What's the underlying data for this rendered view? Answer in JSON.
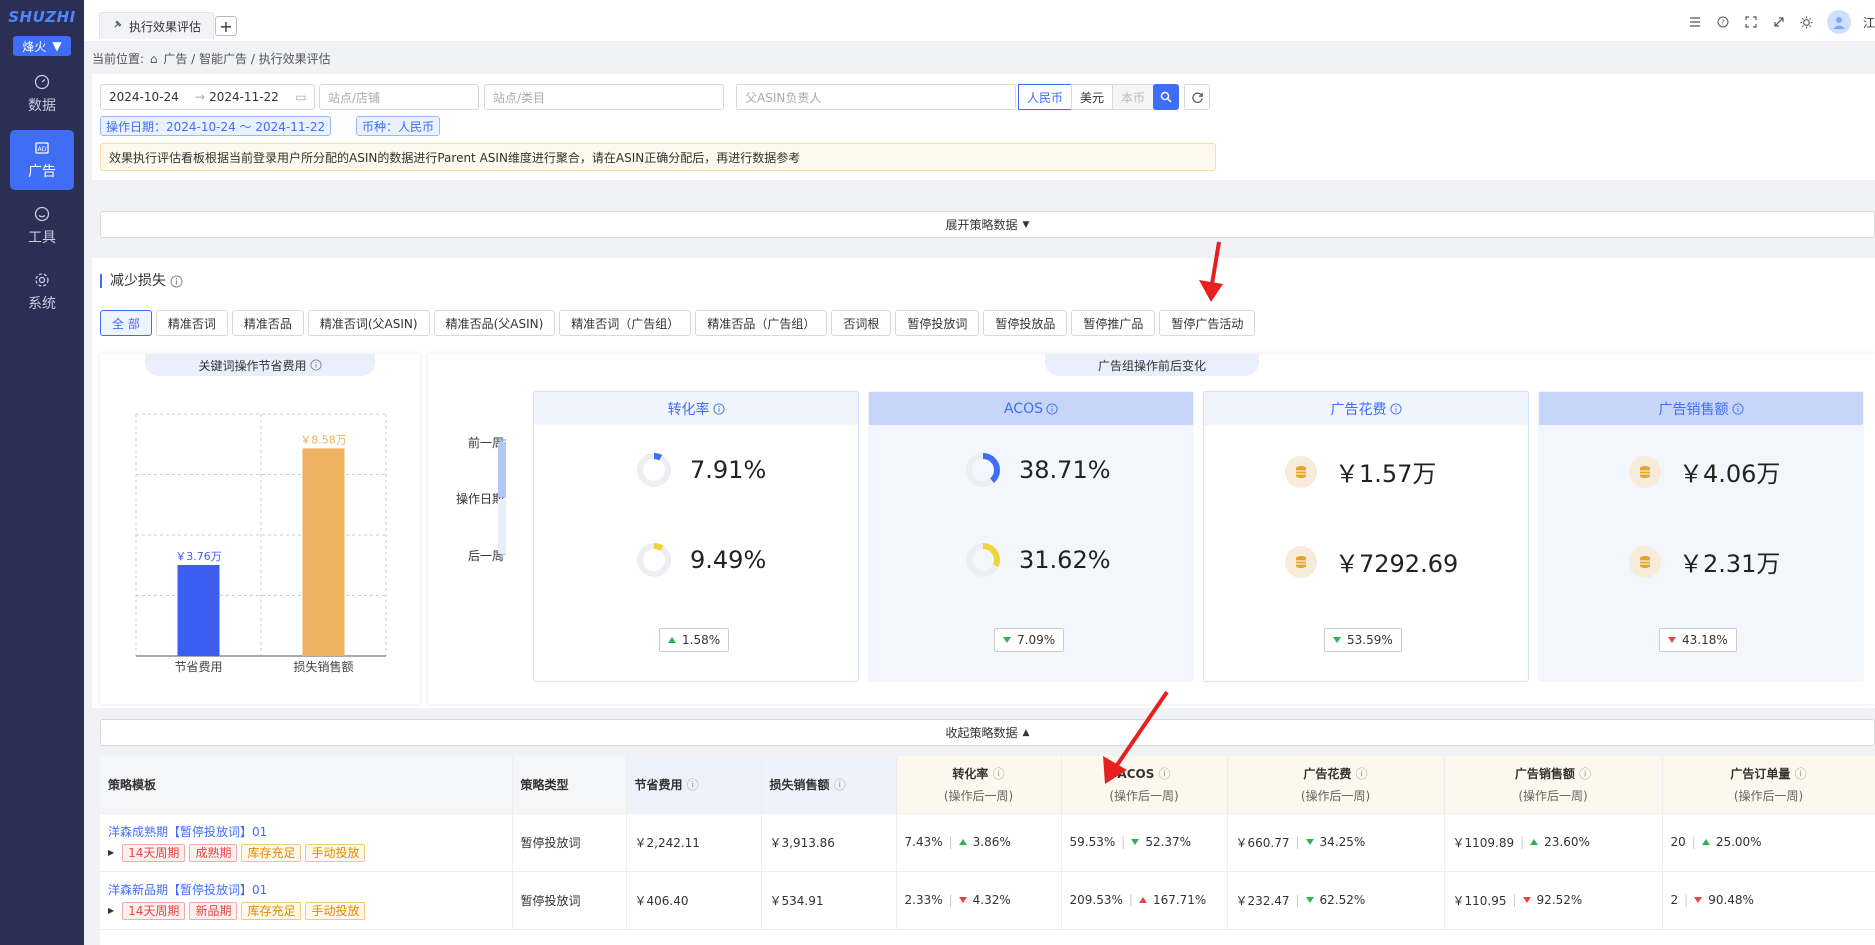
{
  "sidebar": {
    "logo": "SHUZHI",
    "shop": "烽火",
    "items": [
      {
        "label": "数据",
        "icon": "dashboard-icon"
      },
      {
        "label": "广告",
        "icon": "ads-icon"
      },
      {
        "label": "工具",
        "icon": "tool-icon"
      },
      {
        "label": "系统",
        "icon": "gear-icon"
      }
    ],
    "active": "广告"
  },
  "topbar": {
    "tab_label": "执行效果评估",
    "add_label": "+",
    "user_initial": "江",
    "icons": [
      "list-icon",
      "help-icon",
      "fullscreen-icon",
      "expand-icon",
      "theme-icon"
    ]
  },
  "breadcrumb": {
    "prefix": "当前位置:",
    "path": "广告 / 智能广告 / 执行效果评估"
  },
  "filters": {
    "date_start": "2024-10-24",
    "date_end": "2024-11-22",
    "site_store_placeholder": "站点/店铺",
    "site_category_placeholder": "站点/类目",
    "asin_owner_placeholder": "父ASIN负责人",
    "currencies": [
      "人民币",
      "美元",
      "本币"
    ],
    "active_currency": "人民币",
    "tag_date": "操作日期：2024-10-24 ～ 2024-11-22",
    "tag_currency": "币种：人民币",
    "notice": "效果执行评估看板根据当前登录用户所分配的ASIN的数据进行Parent ASIN维度进行聚合，请在ASIN正确分配后，再进行数据参考"
  },
  "expand_bar": "展开策略数据",
  "collapse_bar": "收起策略数据",
  "loss_section": {
    "title": "减少损失",
    "filters": [
      "全 部",
      "精准否词",
      "精准否品",
      "精准否词(父ASIN)",
      "精准否品(父ASIN)",
      "精准否词（广告组）",
      "精准否品（广告组）",
      "否词根",
      "暂停投放词",
      "暂停投放品",
      "暂停推广品",
      "暂停广告活动"
    ],
    "active_filter": "全 部"
  },
  "left_chart": {
    "header": "关键词操作节省费用"
  },
  "chart_data": {
    "type": "bar",
    "categories": [
      "节省费用",
      "损失销售额"
    ],
    "values": [
      3.76,
      8.58
    ],
    "data_labels": [
      "￥3.76万",
      "￥8.58万"
    ],
    "colors": [
      "#3b5ef0",
      "#efb05f"
    ],
    "ylim": [
      0,
      10
    ],
    "grid": true
  },
  "right_panel": {
    "header": "广告组操作前后变化",
    "timeline": [
      "前一周",
      "操作日期",
      "后一周"
    ],
    "metrics": [
      {
        "title": "转化率",
        "before": "7.91%",
        "after": "9.49%",
        "before_ratio": 0.0791,
        "after_ratio": 0.0949,
        "delta": "1.58%",
        "dir": "up",
        "kind": "ring"
      },
      {
        "title": "ACOS",
        "before": "38.71%",
        "after": "31.62%",
        "before_ratio": 0.3871,
        "after_ratio": 0.3162,
        "delta": "7.09%",
        "dir": "down-green",
        "kind": "ring"
      },
      {
        "title": "广告花费",
        "before": "￥1.57万",
        "after": "￥7292.69",
        "delta": "53.59%",
        "dir": "down-green",
        "kind": "coin"
      },
      {
        "title": "广告销售额",
        "before": "￥4.06万",
        "after": "￥2.31万",
        "delta": "43.18%",
        "dir": "down-red",
        "kind": "coin"
      }
    ]
  },
  "table": {
    "headers": {
      "template": "策略模板",
      "type": "策略类型",
      "saved": "节省费用",
      "lost": "损失销售额",
      "cvr": "转化率",
      "acos": "ACOS",
      "spend": "广告花费",
      "sales": "广告销售额",
      "orders": "广告订单量",
      "sub": "(操作后一周)"
    },
    "rows": [
      {
        "name": "洋森成熟期【暂停投放词】01",
        "tags": [
          "14天周期",
          "成熟期",
          "库存充足",
          "手动投放"
        ],
        "type": "暂停投放词",
        "saved": "￥2,242.11",
        "lost": "￥3,913.86",
        "cvr": "7.43%",
        "cvr_d": "3.86%",
        "cvr_dir": "up",
        "acos": "59.53%",
        "acos_d": "52.37%",
        "acos_dir": "down-green",
        "spend": "￥660.77",
        "spend_d": "34.25%",
        "spend_dir": "down-green",
        "sales": "￥1109.89",
        "sales_d": "23.60%",
        "sales_dir": "up",
        "orders": "20",
        "orders_d": "25.00%",
        "orders_dir": "up"
      },
      {
        "name": "洋森新品期【暂停投放词】01",
        "tags": [
          "14天周期",
          "新品期",
          "库存充足",
          "手动投放"
        ],
        "type": "暂停投放词",
        "saved": "￥406.40",
        "lost": "￥534.91",
        "cvr": "2.33%",
        "cvr_d": "4.32%",
        "cvr_dir": "down-red",
        "acos": "209.53%",
        "acos_d": "167.71%",
        "acos_dir": "up-red",
        "spend": "￥232.47",
        "spend_d": "62.52%",
        "spend_dir": "down-green",
        "sales": "￥110.95",
        "sales_d": "92.52%",
        "sales_dir": "down-red",
        "orders": "2",
        "orders_d": "90.48%",
        "orders_dir": "down-red"
      }
    ]
  }
}
